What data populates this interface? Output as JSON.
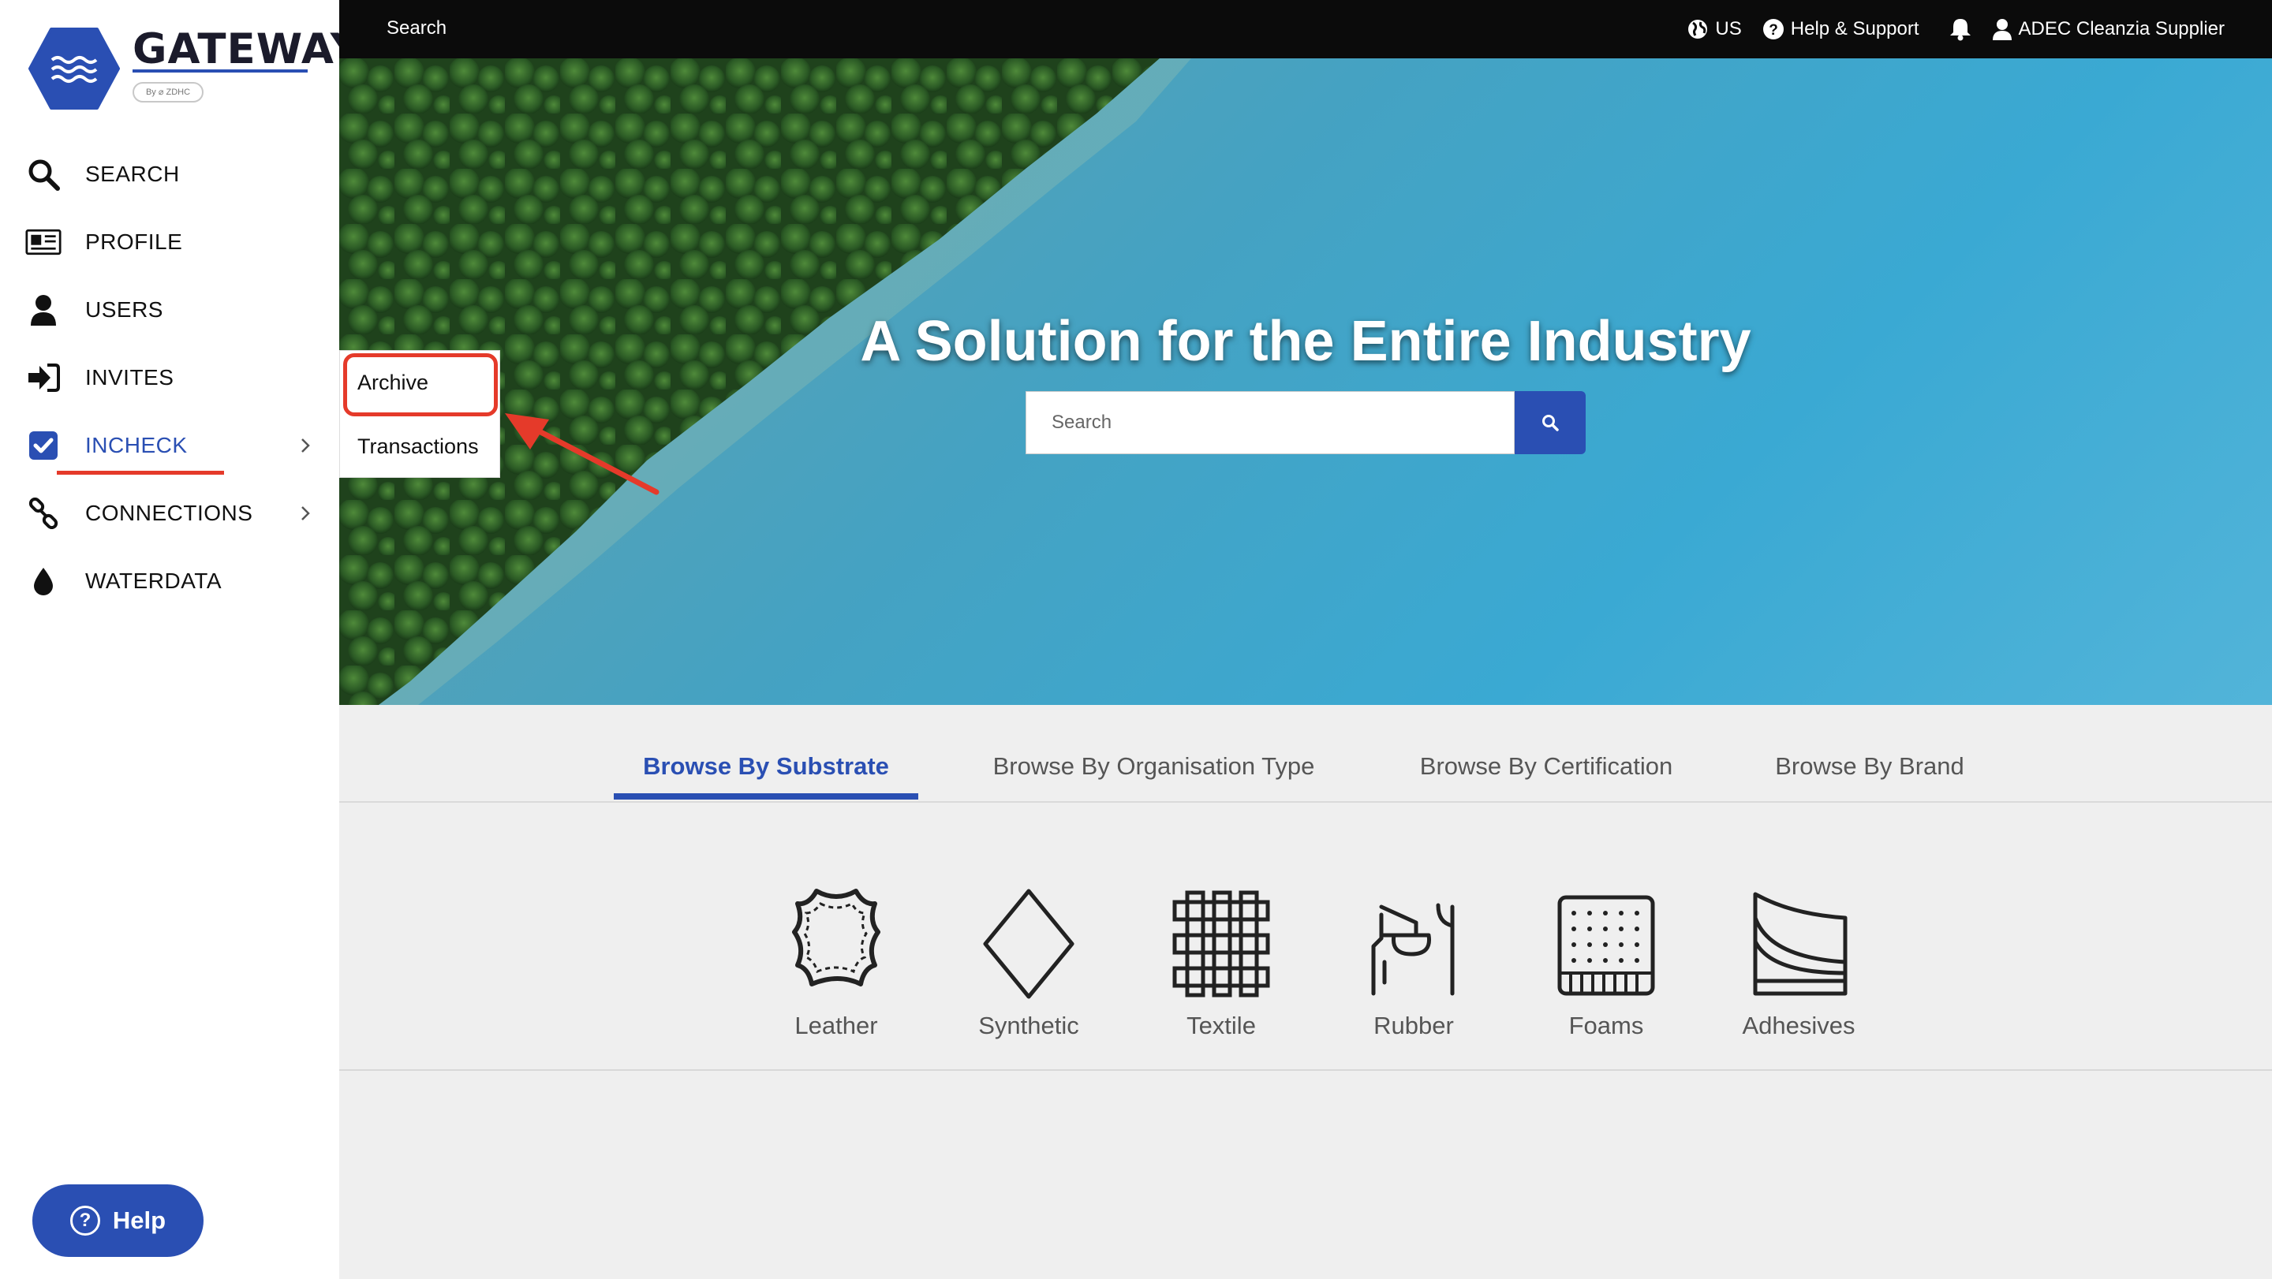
{
  "logo": {
    "title": "GATEWAY",
    "subtitle": "By ⌀ ZDHC"
  },
  "sidebar": {
    "items": [
      {
        "label": "SEARCH"
      },
      {
        "label": "PROFILE"
      },
      {
        "label": "USERS"
      },
      {
        "label": "INVITES"
      },
      {
        "label": "INCHECK"
      },
      {
        "label": "CONNECTIONS"
      },
      {
        "label": "WATERDATA"
      }
    ],
    "help_label": "Help"
  },
  "topbar": {
    "search_label": "Search",
    "region": "US",
    "help_support": "Help & Support",
    "user": "ADEC Cleanzia Supplier"
  },
  "hero": {
    "title": "A Solution for the Entire Industry",
    "search_placeholder": "Search"
  },
  "dropdown": {
    "items": [
      {
        "label": "Archive"
      },
      {
        "label": "Transactions"
      }
    ]
  },
  "browse": {
    "tabs": [
      {
        "label": "Browse By Substrate"
      },
      {
        "label": "Browse By Organisation Type"
      },
      {
        "label": "Browse By Certification"
      },
      {
        "label": "Browse By Brand"
      }
    ],
    "substrates": [
      {
        "label": "Leather",
        "icon": "leather-hide-icon"
      },
      {
        "label": "Synthetic",
        "icon": "diamond-icon"
      },
      {
        "label": "Textile",
        "icon": "woven-grid-icon"
      },
      {
        "label": "Rubber",
        "icon": "rubber-tap-icon"
      },
      {
        "label": "Foams",
        "icon": "foam-block-icon"
      },
      {
        "label": "Adhesives",
        "icon": "adhesive-icon"
      }
    ]
  },
  "colors": {
    "brand": "#2a4fb3",
    "highlight": "#e53a2a",
    "topbar": "#0b0b0b"
  }
}
